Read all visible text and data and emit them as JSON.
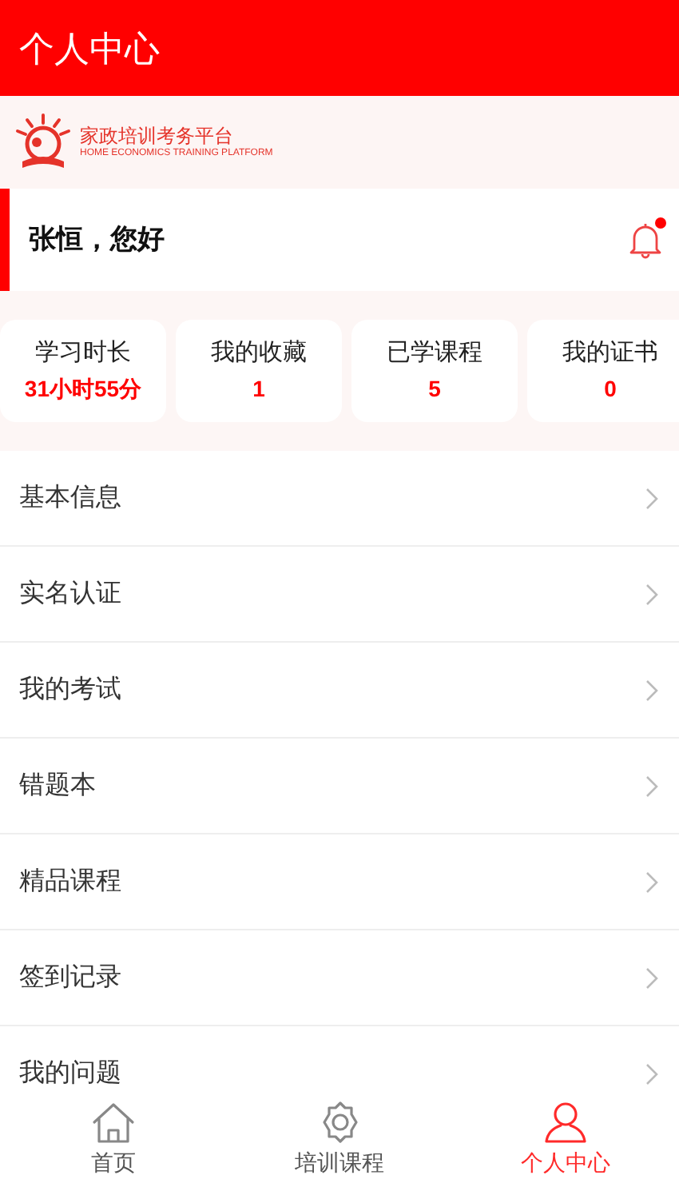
{
  "header": {
    "title": "个人中心"
  },
  "logo": {
    "name": "家政培训考务平台",
    "subtitle": "HOME ECONOMICS TRAINING PLATFORM"
  },
  "greeting": {
    "text": "张恒，您好",
    "has_notification": true
  },
  "stats": [
    {
      "label": "学习时长",
      "value": "31小时55分"
    },
    {
      "label": "我的收藏",
      "value": "1"
    },
    {
      "label": "已学课程",
      "value": "5"
    },
    {
      "label": "我的证书",
      "value": "0"
    }
  ],
  "menu": [
    {
      "label": "基本信息"
    },
    {
      "label": "实名认证"
    },
    {
      "label": "我的考试"
    },
    {
      "label": "错题本"
    },
    {
      "label": "精品课程"
    },
    {
      "label": "签到记录"
    },
    {
      "label": "我的问题"
    }
  ],
  "tabbar": [
    {
      "label": "首页",
      "kind": "home",
      "selected": false
    },
    {
      "label": "培训课程",
      "kind": "gear",
      "selected": false
    },
    {
      "label": "个人中心",
      "kind": "person",
      "selected": true
    }
  ]
}
